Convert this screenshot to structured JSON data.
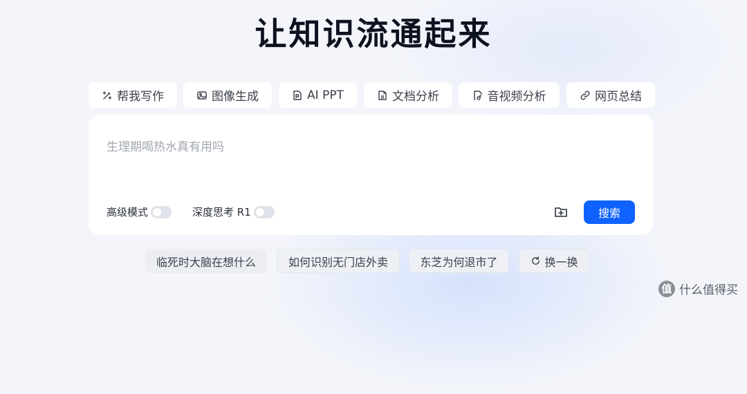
{
  "hero": {
    "title": "让知识流通起来"
  },
  "tabs": [
    {
      "label": "帮我写作",
      "icon": "pen-sparkle-icon"
    },
    {
      "label": "图像生成",
      "icon": "image-icon"
    },
    {
      "label": "AI PPT",
      "icon": "ppt-icon"
    },
    {
      "label": "文档分析",
      "icon": "document-icon"
    },
    {
      "label": "音视频分析",
      "icon": "media-file-icon"
    },
    {
      "label": "网页总结",
      "icon": "link-icon"
    }
  ],
  "search": {
    "placeholder": "生理期喝热水真有用吗",
    "advanced_mode_label": "高级模式",
    "advanced_mode_on": false,
    "deep_think_label": "深度思考 R1",
    "deep_think_on": false,
    "submit_label": "搜索",
    "upload_icon": "folder-plus-icon"
  },
  "suggestions": [
    {
      "label": "临死时大脑在想什么"
    },
    {
      "label": "如何识别无门店外卖"
    },
    {
      "label": "东芝为何退市了"
    }
  ],
  "refresh": {
    "label": "换一换",
    "icon": "refresh-icon"
  },
  "watermark": {
    "badge": "值",
    "text": "什么值得买"
  },
  "colors": {
    "accent": "#0f62fe",
    "background": "#f3f5fa",
    "card": "#ffffff"
  }
}
